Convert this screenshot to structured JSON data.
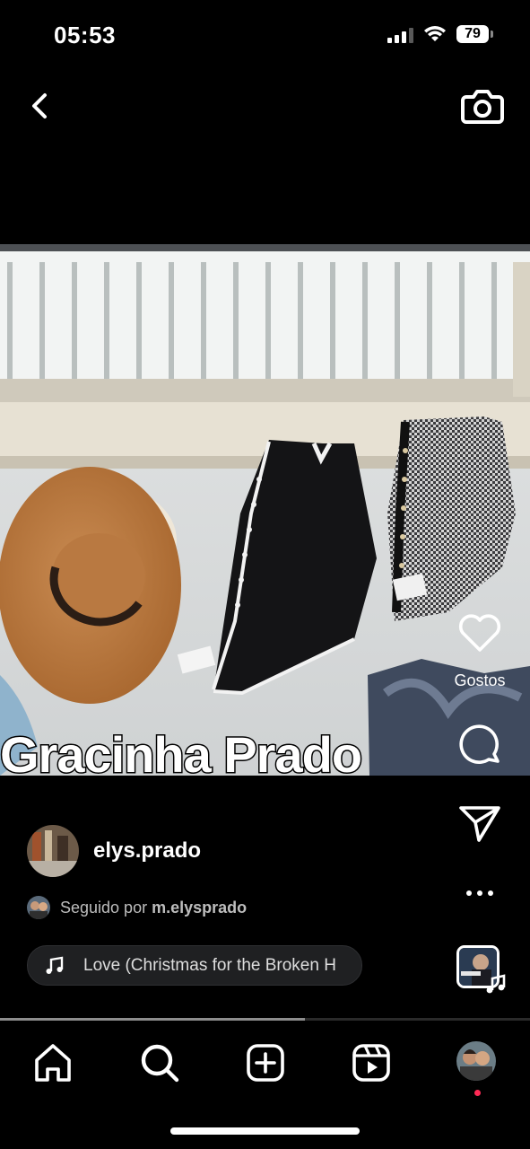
{
  "status_bar": {
    "time": "05:53",
    "battery": "79"
  },
  "post": {
    "overlay_text": "Gracinha Prado",
    "likes_label": "Gostos",
    "author": {
      "username": "elys.prado"
    },
    "followed_by": {
      "prefix": "Seguido por",
      "user": "m.elysprado"
    },
    "music": {
      "title": "Love (Christmas for the Broken H"
    },
    "progress": 0.575
  },
  "icons": {
    "back": "chevron-left-icon",
    "camera": "camera-icon",
    "like": "heart-icon",
    "comment": "comment-icon",
    "share": "paper-plane-icon",
    "more": "more-dots-icon",
    "music": "music-note-icon",
    "nav": [
      "home-icon",
      "search-icon",
      "create-icon",
      "reels-icon",
      "profile-avatar"
    ]
  }
}
